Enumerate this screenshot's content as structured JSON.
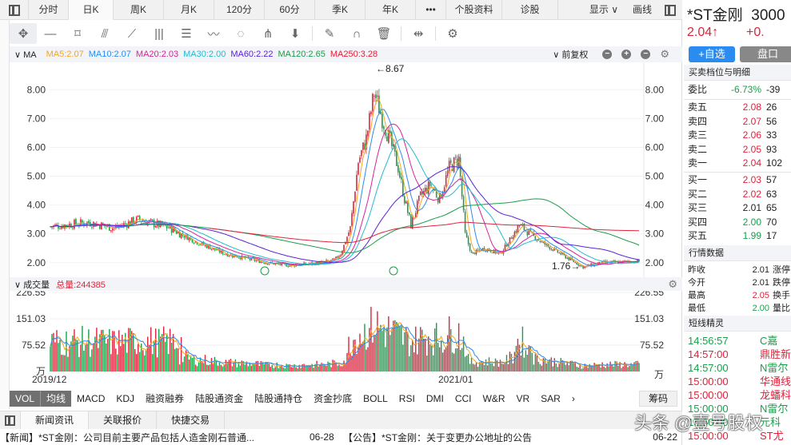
{
  "top_tabs": [
    "分时",
    "日K",
    "周K",
    "月K",
    "120分",
    "60分",
    "季K",
    "年K",
    "•••",
    "个股资料",
    "诊股"
  ],
  "active_tab": "日K",
  "display_label": "显示 ∨",
  "draw_label": "画线",
  "ma_bar": {
    "label": "MA",
    "items": [
      {
        "text": "MA5:2.07",
        "color": "#f5a623"
      },
      {
        "text": "MA10:2.07",
        "color": "#2a8cf0"
      },
      {
        "text": "MA20:2.03",
        "color": "#d8239a"
      },
      {
        "text": "MA30:2.00",
        "color": "#22bcd0"
      },
      {
        "text": "MA60:2.22",
        "color": "#5a22d8"
      },
      {
        "text": "MA120:2.65",
        "color": "#1a9e4a"
      },
      {
        "text": "MA250:3.28",
        "color": "#e0223a"
      }
    ],
    "adjust": "前复权"
  },
  "volume_bar": {
    "label": "成交量",
    "total": "总量:244385"
  },
  "chart_data": {
    "type": "candlestick",
    "y_ticks": [
      "8.00",
      "7.00",
      "6.00",
      "5.00",
      "4.00",
      "3.00",
      "2.00"
    ],
    "ylim": [
      1.55,
      8.95
    ],
    "x_labels": [
      "2019/12",
      "2021/01"
    ],
    "max_label": "←8.67",
    "min_label": "1.76→",
    "close_path": [
      [
        0,
        3.2
      ],
      [
        12,
        3.3
      ],
      [
        24,
        3.4
      ],
      [
        40,
        3.2
      ],
      [
        55,
        3.5
      ],
      [
        70,
        3.3
      ],
      [
        85,
        2.9
      ],
      [
        100,
        2.6
      ],
      [
        115,
        2.3
      ],
      [
        135,
        2.0
      ],
      [
        150,
        1.9
      ],
      [
        170,
        2.0
      ],
      [
        185,
        2.05
      ],
      [
        200,
        2.1
      ],
      [
        215,
        2.2
      ],
      [
        175,
        2.05
      ],
      [
        180,
        2.2
      ],
      [
        225,
        2.3
      ],
      [
        230,
        3.0
      ],
      [
        238,
        5.5
      ],
      [
        245,
        6.0
      ],
      [
        253,
        7.5
      ],
      [
        262,
        7.8
      ],
      [
        270,
        6.5
      ],
      [
        278,
        5.0
      ],
      [
        285,
        4.2
      ],
      [
        292,
        3.3
      ],
      [
        300,
        4.0
      ],
      [
        305,
        4.8
      ],
      [
        315,
        4.3
      ],
      [
        325,
        5.2
      ],
      [
        335,
        5.5
      ],
      [
        250,
        6.3
      ]
    ],
    "vol_ticks": [
      "226.55",
      "151.03",
      "75.52",
      "万"
    ],
    "vol_max": 226.55
  },
  "indicator_tabs": [
    "VOL",
    "均线",
    "MACD",
    "KDJ",
    "融资融券",
    "陆股通资金",
    "陆股通持仓",
    "资金抄底",
    "BOLL",
    "RSI",
    "DMI",
    "CCI",
    "W&R",
    "VR",
    "SAR",
    "›"
  ],
  "chip_label": "筹码",
  "bottom_tabs": [
    "新闻资讯",
    "关联报价",
    "快捷交易"
  ],
  "news": [
    {
      "text": "【新闻】*ST金刚：公司目前主要产品包括人造金刚石普通...",
      "date": "06-28"
    },
    {
      "text": "【公告】*ST金刚：关于变更办公地址的公告",
      "date": "06-22"
    }
  ],
  "quote": {
    "name": "*ST金刚",
    "code": "3000",
    "price": "2.04↑",
    "change": "+0.",
    "add_watch": "+自选",
    "panel": "盘口",
    "sec1": "买卖档位与明细",
    "weibi": {
      "label": "委比",
      "pct": "-6.73%",
      "val": "-39"
    },
    "asks": [
      {
        "l": "卖五",
        "p": "2.08",
        "v": "26"
      },
      {
        "l": "卖四",
        "p": "2.07",
        "v": "56"
      },
      {
        "l": "卖三",
        "p": "2.06",
        "v": "33"
      },
      {
        "l": "卖二",
        "p": "2.05",
        "v": "93"
      },
      {
        "l": "卖一",
        "p": "2.04",
        "v": "102"
      }
    ],
    "bids": [
      {
        "l": "买一",
        "p": "2.03",
        "v": "57"
      },
      {
        "l": "买二",
        "p": "2.02",
        "v": "63"
      },
      {
        "l": "买三",
        "p": "2.01",
        "v": "65"
      },
      {
        "l": "买四",
        "p": "2.00",
        "v": "70"
      },
      {
        "l": "买五",
        "p": "1.99",
        "v": "17"
      }
    ],
    "sec2": "行情数据",
    "stats": [
      {
        "l": "昨收",
        "v": "2.01",
        "r": "涨停"
      },
      {
        "l": "今开",
        "v": "2.01",
        "r": "跌停"
      },
      {
        "l": "最高",
        "v": "2.05",
        "r": "换手"
      },
      {
        "l": "最低",
        "v": "2.00",
        "r": "量比"
      }
    ],
    "sec3": "短线精灵",
    "alerts": [
      {
        "t": "14:56:57",
        "n": "C嘉",
        "c": "green"
      },
      {
        "t": "14:57:00",
        "n": "鼎胜新",
        "c": "red"
      },
      {
        "t": "14:57:00",
        "n": "N雷尔",
        "c": "green"
      },
      {
        "t": "15:00:00",
        "n": "华通线",
        "c": "red"
      },
      {
        "t": "15:00:00",
        "n": "龙蟠科",
        "c": "red"
      },
      {
        "t": "15:00:00",
        "n": "N雷尔",
        "c": "green"
      },
      {
        "t": "15:00:00",
        "n": "元科",
        "c": "green"
      },
      {
        "t": "15:00:00",
        "n": "ST尤",
        "c": "red"
      }
    ]
  },
  "watermark": "头条 @壹号股权"
}
